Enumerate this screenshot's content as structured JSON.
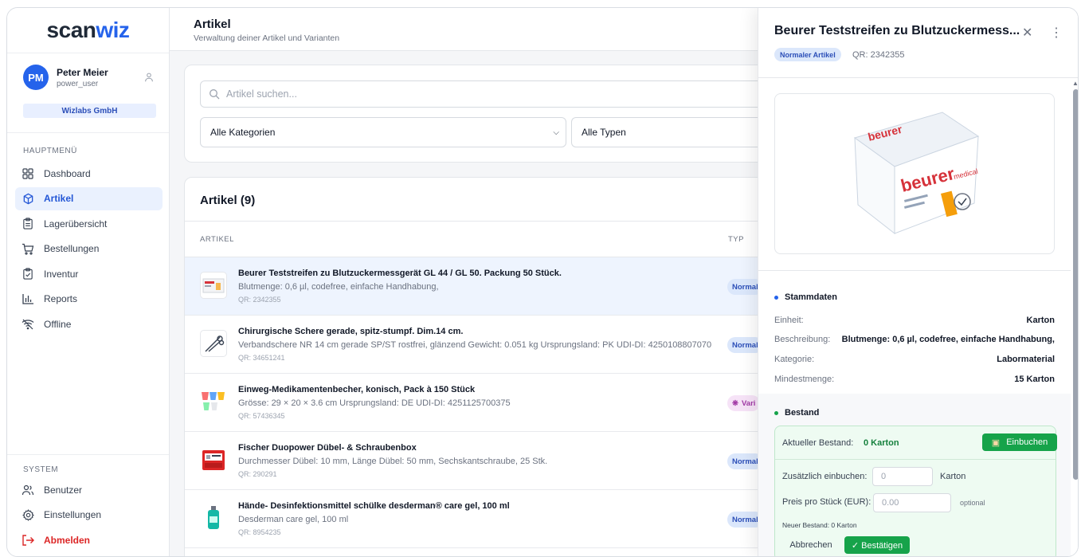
{
  "app": {
    "logo_a": "scan",
    "logo_b": "wiz"
  },
  "user": {
    "initials": "PM",
    "name": "Peter Meier",
    "role": "power_user",
    "company": "Wizlabs GmbH"
  },
  "sidebar": {
    "main_label": "HAUPTMENÜ",
    "items": [
      {
        "label": "Dashboard",
        "icon": "dashboard-icon"
      },
      {
        "label": "Artikel",
        "icon": "box-icon",
        "active": true
      },
      {
        "label": "Lagerübersicht",
        "icon": "clipboard-icon"
      },
      {
        "label": "Bestellungen",
        "icon": "cart-icon"
      },
      {
        "label": "Inventur",
        "icon": "clipboard-check-icon"
      },
      {
        "label": "Reports",
        "icon": "bar-chart-icon"
      },
      {
        "label": "Offline",
        "icon": "wifi-off-icon"
      }
    ],
    "system_label": "SYSTEM",
    "system_items": [
      {
        "label": "Benutzer",
        "icon": "users-icon"
      },
      {
        "label": "Einstellungen",
        "icon": "gear-icon"
      },
      {
        "label": "Abmelden",
        "icon": "logout-icon"
      }
    ]
  },
  "header": {
    "title": "Artikel",
    "subtitle": "Verwaltung deiner Artikel und Varianten"
  },
  "filters": {
    "search_placeholder": "Artikel suchen...",
    "category": "Alle Kategorien",
    "type": "Alle Typen"
  },
  "list": {
    "title": "Artikel (9)",
    "col_article": "ARTIKEL",
    "col_type": "TYP",
    "rows": [
      {
        "title": "Beurer Teststreifen zu Blutzuckermessgerät GL 44 / GL 50. Packung 50 Stück.",
        "desc": "Blutmenge: 0,6 µl, codefree, einfache Handhabung,",
        "qr": "QR: 2342355",
        "type": "Normal",
        "badge": "normal"
      },
      {
        "title": "Chirurgische Schere gerade, spitz-stumpf. Dim.14 cm.",
        "desc": "Verbandschere NR 14 cm gerade SP/ST rostfrei, glänzend Gewicht: 0.051 kg Ursprungsland: PK UDI-DI: 4250108807070",
        "qr": "QR: 34651241",
        "type": "Normal",
        "badge": "normal"
      },
      {
        "title": "Einweg-Medikamentenbecher, konisch, Pack à 150 Stück",
        "desc": "Grösse: 29 × 20 × 3.6 cm Ursprungsland: DE UDI-DI: 4251125700375",
        "qr": "QR: 57436345",
        "type": "Vari",
        "badge": "var"
      },
      {
        "title": "Fischer Duopower Dübel- & Schraubenbox",
        "desc": "Durchmesser Dübel: 10 mm, Länge Dübel: 50 mm, Sechskantschraube, 25 Stk.",
        "qr": "QR: 290291",
        "type": "Normal",
        "badge": "normal"
      },
      {
        "title": "Hände- Desinfektionsmittel schülke desderman® care gel, 100 ml",
        "desc": "Desderman care gel, 100 ml",
        "qr": "QR: 8954235",
        "type": "Normal",
        "badge": "normal"
      }
    ]
  },
  "panel": {
    "title": "Beurer Teststreifen zu Blutzuckermess...",
    "badge": "Normaler Artikel",
    "qr": "QR: 2342355",
    "image_brand": "beurer",
    "image_sub": "medical",
    "stammdaten_title": "Stammdaten",
    "fields": [
      {
        "k": "Einheit:",
        "v": "Karton"
      },
      {
        "k": "Beschreibung:",
        "v": "Blutmenge: 0,6 µl, codefree, einfache Handhabung,"
      },
      {
        "k": "Kategorie:",
        "v": "Labormaterial"
      },
      {
        "k": "Mindestmenge:",
        "v": "15 Karton"
      }
    ],
    "bestand_title": "Bestand",
    "current_label": "Aktueller Bestand:",
    "current_value": "0 Karton",
    "einbuchen_btn": "Einbuchen",
    "add_label": "Zusätzlich einbuchen:",
    "add_value": "0",
    "add_unit": "Karton",
    "price_label": "Preis pro Stück (EUR):",
    "price_placeholder": "0.00",
    "price_hint": "optional",
    "new_stock": "Neuer Bestand: 0 Karton",
    "cancel_btn": "Abbrechen",
    "confirm_btn": "✓ Bestätigen"
  },
  "colors": {
    "accent": "#2563eb",
    "success": "#16a34a",
    "danger": "#dc2626"
  }
}
